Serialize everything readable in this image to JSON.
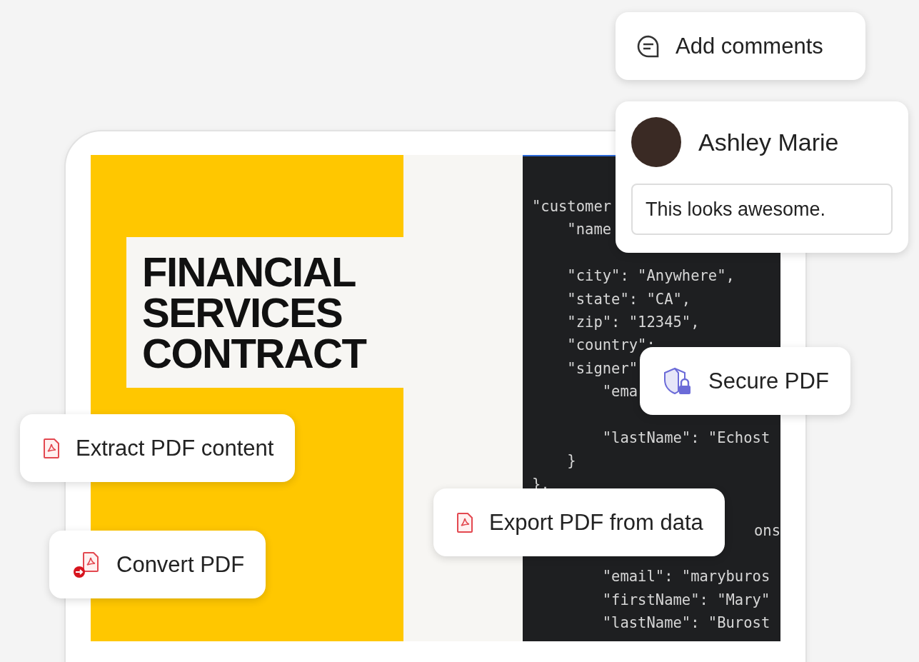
{
  "comment_action": {
    "label": "Add comments"
  },
  "comment": {
    "author": "Ashley Marie",
    "value": "This looks awesome."
  },
  "document": {
    "title_lines": [
      "FINANCIAL",
      "SERVICES",
      "CONTRACT"
    ]
  },
  "code": {
    "blocks": [
      {
        "kind": "code",
        "lines": [
          "\"customer",
          "    \"name"
        ]
      },
      {
        "kind": "code",
        "lines": [
          "    \"city\": \"Anywhere\",",
          "    \"state\": \"CA\",",
          "    \"zip\": \"12345\",",
          "    \"country\":",
          "    \"signer\"",
          "        \"ema"
        ]
      },
      {
        "kind": "code",
        "lines": [
          "        \"lastName\": \"Echost",
          "    }",
          "},"
        ]
      },
      {
        "kind": "tail",
        "lines": [
          "ons"
        ]
      },
      {
        "kind": "code",
        "lines": [
          "        \"email\": \"maryburos",
          "        \"firstName\": \"Mary\"",
          "        \"lastName\": \"Burost"
        ]
      }
    ]
  },
  "actions": [
    {
      "kind": "secure",
      "label": "Secure PDF"
    },
    {
      "kind": "extract",
      "label": "Extract PDF content"
    },
    {
      "kind": "export",
      "label": "Export PDF from data"
    },
    {
      "kind": "convert",
      "label": "Convert PDF"
    }
  ]
}
